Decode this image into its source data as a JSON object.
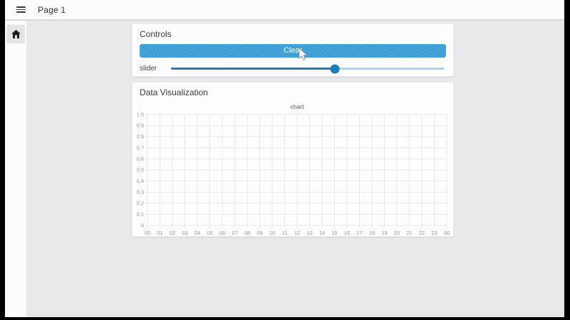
{
  "window": {
    "page_title": "Page 1"
  },
  "sidebar": {
    "items": [
      {
        "icon": "home-icon"
      }
    ]
  },
  "controls_card": {
    "title": "Controls",
    "clear_button_label": "Clear",
    "slider_label": "slider",
    "slider_value_percent": 60
  },
  "viz_card": {
    "title": "Data Visualization"
  },
  "chart_data": {
    "type": "line",
    "title": "chart",
    "series": [],
    "x_tick_labels": [
      "00",
      "01",
      "02",
      "03",
      "04",
      "05",
      "06",
      "07",
      "08",
      "09",
      "10",
      "11",
      "12",
      "13",
      "14",
      "15",
      "16",
      "17",
      "18",
      "19",
      "20",
      "21",
      "22",
      "23",
      "00"
    ],
    "y_tick_labels": [
      "1.0",
      "0.9",
      "0.8",
      "0.7",
      "0.6",
      "0.5",
      "0.4",
      "0.3",
      "0.2",
      "0.1",
      "0"
    ],
    "ylim": [
      0,
      1
    ],
    "grid": true,
    "legend": false
  },
  "colors": {
    "accent_blue": "#3da1d8",
    "slider_blue": "#1c7db9",
    "slider_track_light": "#abd3e9",
    "content_bg": "#e9e8ea",
    "card_bg": "#fdfcfe",
    "grid_line": "#e8e7ed",
    "tick_text": "#999999",
    "chart_title_text": "#515151"
  }
}
